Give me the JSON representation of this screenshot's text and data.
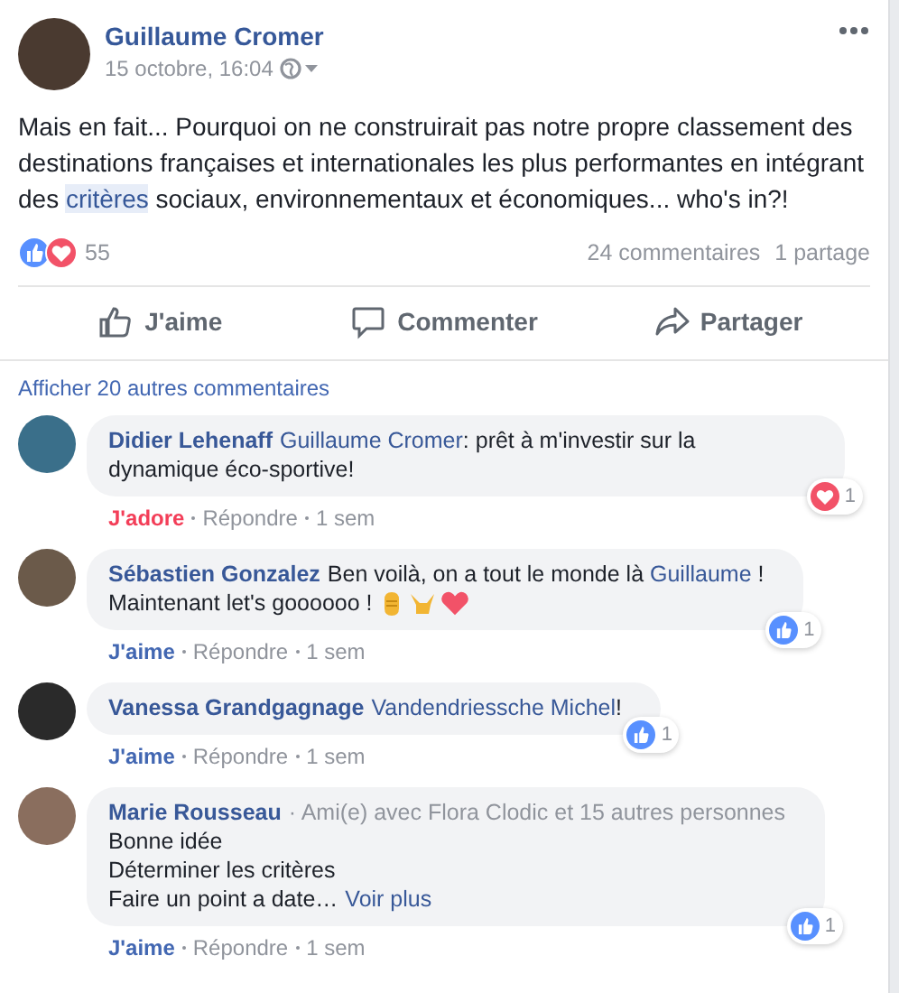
{
  "post": {
    "author": "Guillaume Cromer",
    "time": "15 octobre, 16:04",
    "text": [
      {
        "text": "Mais en fait... Pourquoi on ne construirait pas notre propre classement des destinations françaises et internationales les plus performantes en intégrant des ",
        "highlighted": false
      },
      {
        "text": "critères",
        "highlighted": true
      },
      {
        "text": " sociaux, environnementaux et économiques... who's in?!",
        "highlighted": false
      }
    ],
    "reaction_count": "55",
    "comments": "24 commentaires",
    "shares": "1 partage"
  },
  "actions": [
    {
      "kind": "like",
      "label": "J'aime"
    },
    {
      "kind": "comment",
      "label": "Commenter"
    },
    {
      "kind": "share",
      "label": "Partager"
    }
  ],
  "more_comments": "Afficher 20 autres commentaires",
  "comments": [
    {
      "author": "Didier Lehenaff",
      "lines": [
        [
          {
            "kind": "mention",
            "text": "Guillaume Cromer"
          },
          {
            "kind": "text",
            "text": ": prêt à m'investir sur la dynamique éco-sportive!"
          }
        ]
      ],
      "reaction": {
        "kind": "love",
        "label": "J'adore"
      },
      "reply": "Répondre",
      "time": "1 sem",
      "badge": {
        "kind": "love",
        "count": "1"
      }
    },
    {
      "author": "Sébastien Gonzalez",
      "lines": [
        [
          {
            "kind": "text",
            "text": "Ben voilà, on a tout le monde là "
          },
          {
            "kind": "mention",
            "text": "Guillaume"
          },
          {
            "kind": "text",
            "text": " !"
          }
        ],
        [
          {
            "kind": "text",
            "text": "Maintenant let's goooooo !"
          }
        ]
      ],
      "emojis": [
        {
          "kind": "fist"
        },
        {
          "kind": "horns"
        },
        {
          "kind": "heart"
        }
      ],
      "reaction": {
        "kind": "like",
        "label": "J'aime"
      },
      "reply": "Répondre",
      "time": "1 sem",
      "badge": {
        "kind": "like",
        "count": "1"
      }
    },
    {
      "author": "Vanessa Grandgagnage",
      "lines": [
        [
          {
            "kind": "mention",
            "text": "Vandendriessche Michel"
          },
          {
            "kind": "text",
            "text": "!"
          }
        ]
      ],
      "reaction": {
        "kind": "like",
        "label": "J'aime"
      },
      "reply": "Répondre",
      "time": "1 sem",
      "badge": {
        "kind": "like",
        "count": "1"
      }
    },
    {
      "author": "Marie Rousseau",
      "note": "· Ami(e) avec Flora Clodic et 15 autres personnes",
      "lines": [
        [
          {
            "kind": "text",
            "text": "Bonne idée"
          }
        ],
        [
          {
            "kind": "text",
            "text": "Déterminer les critères"
          }
        ],
        [
          {
            "kind": "text",
            "text": "Faire un point a date…"
          }
        ]
      ],
      "see_more": "Voir plus",
      "reaction": {
        "kind": "like",
        "label": "J'aime"
      },
      "reply": "Répondre",
      "time": "1 sem",
      "badge": {
        "kind": "like",
        "count": "1"
      }
    }
  ]
}
